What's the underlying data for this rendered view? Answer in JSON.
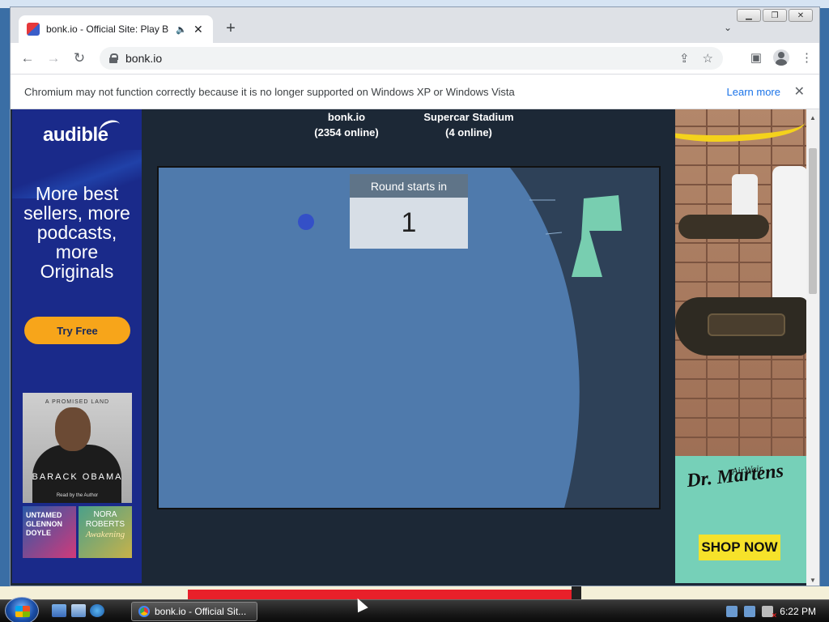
{
  "window": {
    "minimize_glyph": "▁",
    "restore_glyph": "❐",
    "close_glyph": "✕"
  },
  "tab": {
    "title": "bonk.io - Official Site: Play B",
    "speaker_glyph": "🔈",
    "close_glyph": "✕",
    "new_tab_glyph": "+",
    "tab_search_glyph": "⌄"
  },
  "toolbar": {
    "back_glyph": "←",
    "forward_glyph": "→",
    "reload_glyph": "↻",
    "url": "bonk.io",
    "share_glyph": "⇪",
    "star_glyph": "☆",
    "sidepanel_glyph": "▣",
    "menu_glyph": "⋮"
  },
  "infobar": {
    "message": "Chromium may not function correctly because it is no longer supported on Windows XP or Windows Vista",
    "learn_more": "Learn more",
    "close_glyph": "✕"
  },
  "ad_left": {
    "brand": "audible",
    "copy": "More best sellers, more podcasts, more Originals",
    "cta": "Try Free",
    "book_main_tag": "A PROMISED LAND",
    "book_main_author": "BARACK OBAMA",
    "book_main_reader": "Read by the Author",
    "book_a": "UNTAMED GLENNON DOYLE",
    "book_b_author": "NORA ROBERTS",
    "book_b_title": "Awakening"
  },
  "game": {
    "server_name": "bonk.io",
    "server_online": "(2354 online)",
    "room_name": "Supercar Stadium",
    "room_online": "(4 online)",
    "countdown_label": "Round starts in",
    "countdown_value": "1",
    "player_name": ""
  },
  "ad_right": {
    "brand": "Dr. Martens",
    "brand_sub": "AirWair",
    "cta": "SHOP NOW"
  },
  "taskbar": {
    "task_label": "bonk.io - Official Sit...",
    "clock": "6:22 PM"
  },
  "colors": {
    "game_bg": "#2e4158",
    "arena": "#4f7aac",
    "platform": "#78ceb0",
    "player": "#3450c7",
    "cta_orange": "#f7a51a",
    "shop_yellow": "#f6e22a"
  }
}
